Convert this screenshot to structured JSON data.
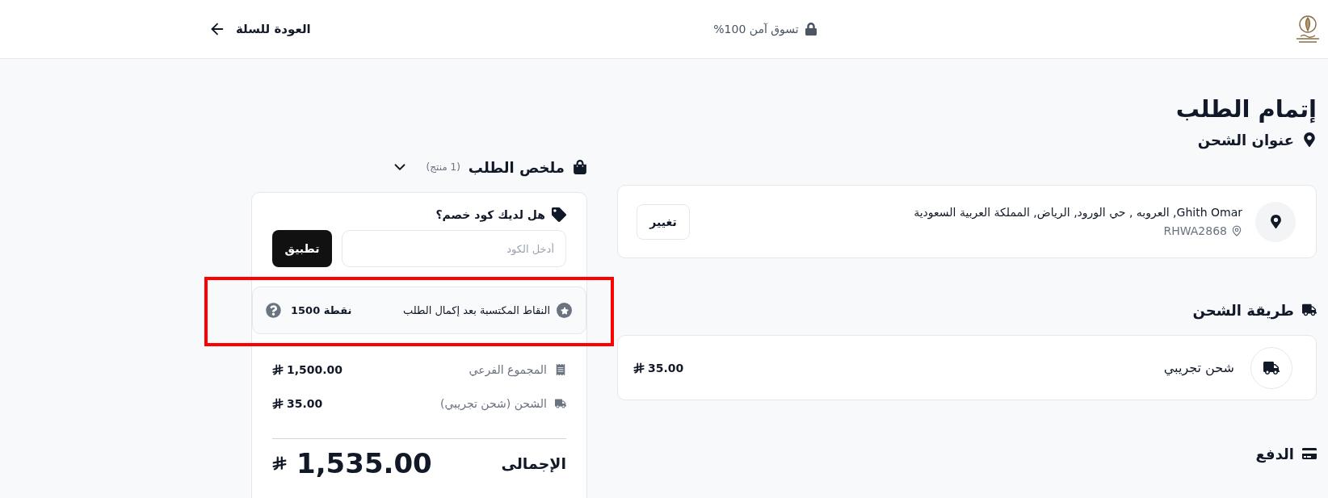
{
  "header": {
    "secure_label": "تسوق آمن 100%",
    "back_link": "العودة للسلة"
  },
  "page_title": "إتمام الطلب",
  "shipping_address": {
    "heading": "عنوان الشحن",
    "address": "Ghith Omar, العروبه , حي الورود, الرياض, المملكة العربية السعودية",
    "code": "RHWA2868",
    "change_button": "تغيير"
  },
  "shipping_method": {
    "heading": "طريقة الشحن",
    "option_name": "شحن تجريبي",
    "price": "35.00"
  },
  "payment": {
    "heading": "الدفع"
  },
  "order_summary": {
    "heading": "ملخص الطلب",
    "item_count": "(1 منتج)",
    "expanded": false,
    "coupon": {
      "label": "هل لديك كود خصم؟",
      "placeholder": "أدخل الكود",
      "apply_button": "تطبيق"
    },
    "points": {
      "label": "النقاط المكتسبة بعد إكمال الطلب",
      "value": "1500 نقطة",
      "highlighted": true
    },
    "lines": [
      {
        "kind": "subtotal",
        "label": "المجموع الفرعي",
        "amount": "1,500.00"
      },
      {
        "kind": "shipping",
        "label": "الشحن (شحن تجريبي)",
        "amount": "35.00"
      }
    ],
    "total": {
      "label": "الإجمالى",
      "amount": "1,535.00"
    }
  }
}
